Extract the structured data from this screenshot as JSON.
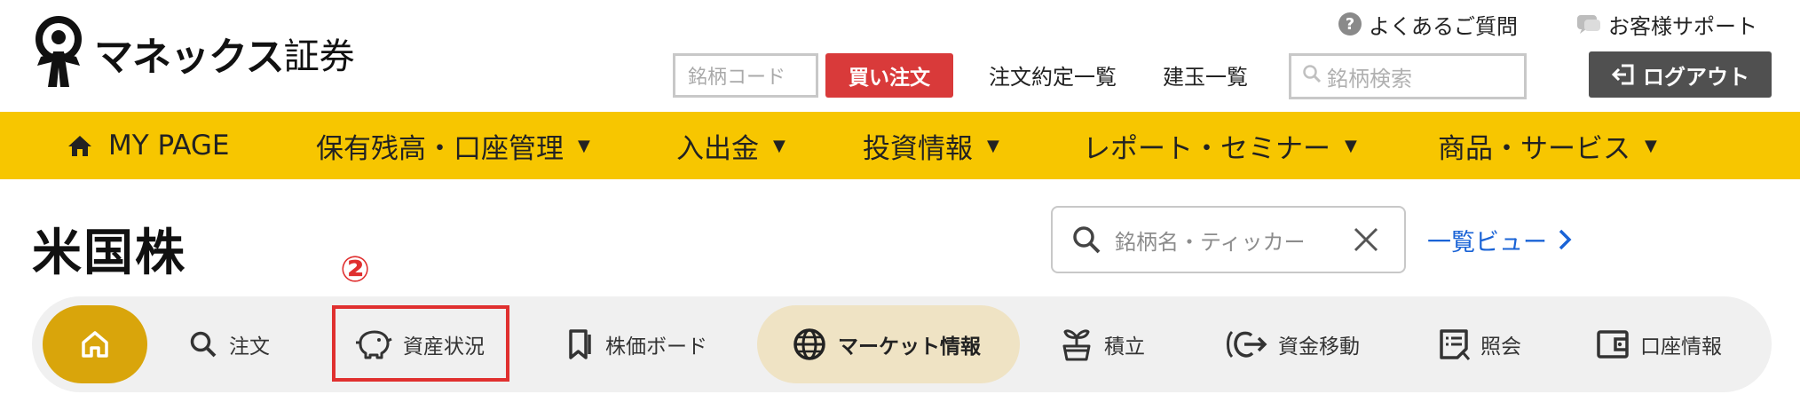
{
  "header": {
    "logo_text": "マネックス",
    "logo_sub": "証券",
    "help_label": "よくあるご質問",
    "support_label": "お客様サポート",
    "code_placeholder": "銘柄コード",
    "buy_label": "買い注文",
    "orders_label": "注文約定一覧",
    "positions_label": "建玉一覧",
    "search_placeholder": "銘柄検索",
    "logout_label": "ログアウト"
  },
  "mainnav": {
    "items": [
      {
        "label": "MY PAGE"
      },
      {
        "label": "保有残高・口座管理"
      },
      {
        "label": "入出金"
      },
      {
        "label": "投資情報"
      },
      {
        "label": "レポート・セミナー"
      },
      {
        "label": "商品・サービス"
      }
    ]
  },
  "page": {
    "title": "米国株",
    "ticker_search_placeholder": "銘柄名・ティッカー",
    "list_view_label": "一覧ビュー",
    "annotation_number": "②"
  },
  "tabs": {
    "items": [
      {
        "label": "注文"
      },
      {
        "label": "資産状況"
      },
      {
        "label": "株価ボード"
      },
      {
        "label": "マーケット情報"
      },
      {
        "label": "積立"
      },
      {
        "label": "資金移動"
      },
      {
        "label": "照会"
      },
      {
        "label": "口座情報"
      }
    ],
    "active": "マーケット情報"
  },
  "colors": {
    "nav_yellow": "#f7c600",
    "home_tab": "#d9a50b",
    "active_tab": "#efe3c4",
    "buy_red": "#d93a3a",
    "logout_gray": "#505050",
    "link_blue": "#1a63d6",
    "annotation_red": "#e0302f"
  }
}
